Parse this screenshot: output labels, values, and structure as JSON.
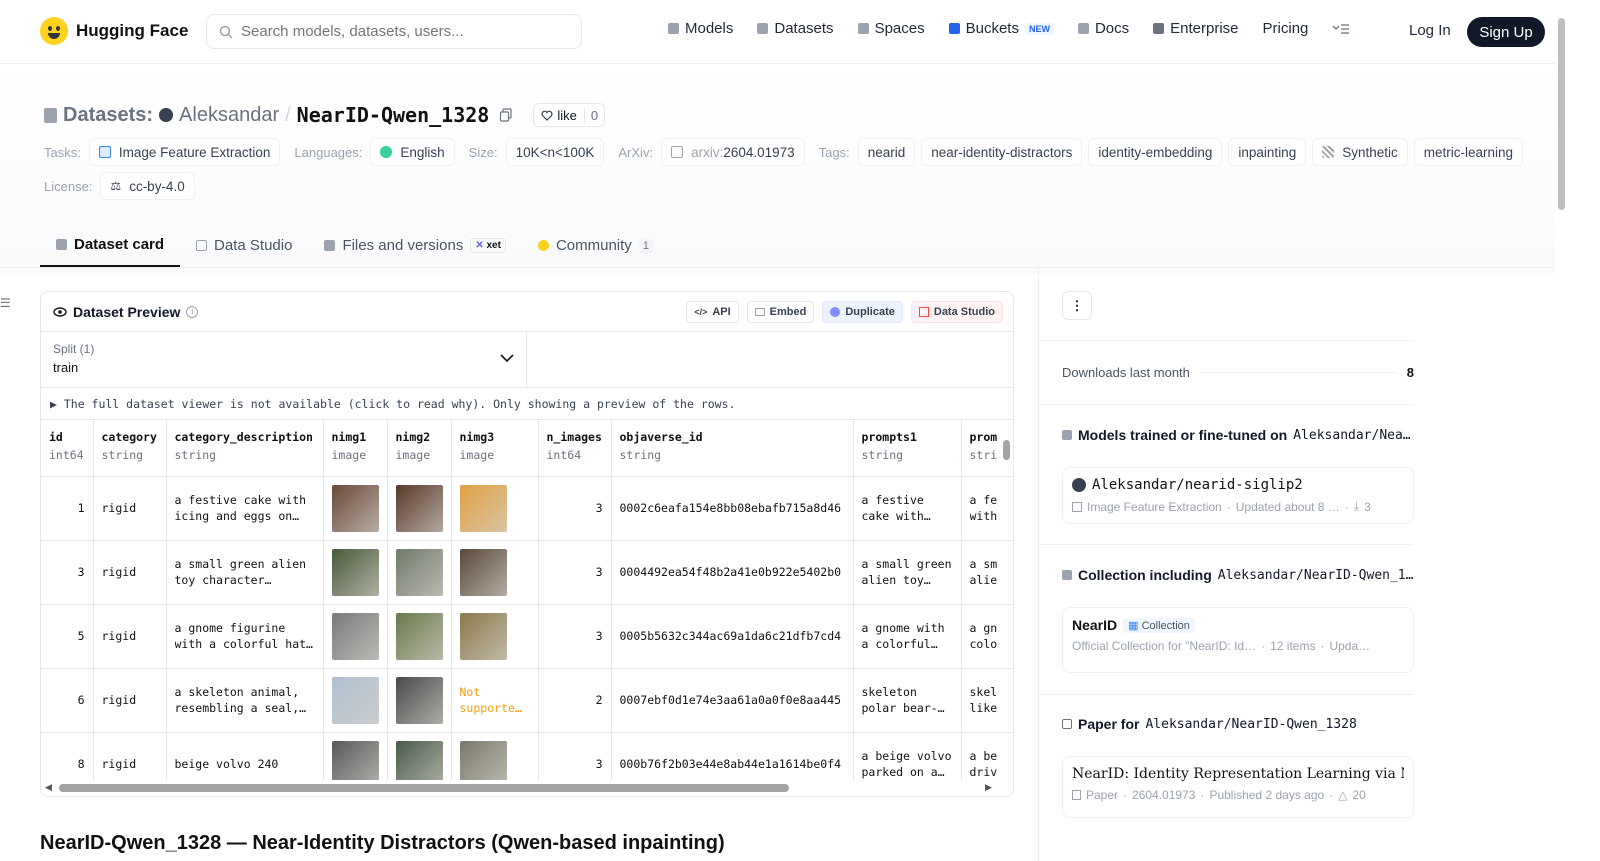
{
  "nav": {
    "brand": "Hugging Face",
    "search_placeholder": "Search models, datasets, users...",
    "links": [
      {
        "label": "Models",
        "color": "#9ca3af"
      },
      {
        "label": "Datasets",
        "color": "#9ca3af"
      },
      {
        "label": "Spaces",
        "color": "#9ca3af"
      },
      {
        "label": "Buckets",
        "color": "#2563eb",
        "badge": "NEW"
      },
      {
        "label": "Docs",
        "color": "#9ca3af"
      },
      {
        "label": "Enterprise",
        "color": "#6b7280"
      },
      {
        "label": "Pricing"
      }
    ],
    "login": "Log In",
    "signup": "Sign Up"
  },
  "header": {
    "section_label": "Datasets:",
    "owner": "Aleksandar",
    "slash": "/",
    "name": "NearID-Qwen_1328",
    "like_label": "like",
    "like_count": "0",
    "tasks_label": "Tasks:",
    "task": "Image Feature Extraction",
    "languages_label": "Languages:",
    "language": "English",
    "size_label": "Size:",
    "size": "10K<n<100K",
    "arxiv_label": "ArXiv:",
    "arxiv_prefix": "arxiv:",
    "arxiv": "2604.01973",
    "tags_label": "Tags:",
    "tags": [
      "nearid",
      "near-identity-distractors",
      "identity-embedding",
      "inpainting",
      "Synthetic",
      "metric-learning"
    ],
    "license_label": "License:",
    "license": "cc-by-4.0"
  },
  "tabs": [
    {
      "label": "Dataset card",
      "active": true
    },
    {
      "label": "Data Studio"
    },
    {
      "label": "Files and versions",
      "badge": "xet"
    },
    {
      "label": "Community",
      "count": "1"
    }
  ],
  "preview": {
    "title": "Dataset Preview",
    "buttons": [
      "API",
      "Embed",
      "Duplicate",
      "Data Studio"
    ],
    "split_label": "Split (1)",
    "split_value": "train",
    "notice": "▶ The full dataset viewer is not available (click to read why). Only showing a preview of the rows.",
    "columns": [
      {
        "name": "id",
        "type": "int64"
      },
      {
        "name": "category",
        "type": "string"
      },
      {
        "name": "category_description",
        "type": "string"
      },
      {
        "name": "nimg1",
        "type": "image"
      },
      {
        "name": "nimg2",
        "type": "image"
      },
      {
        "name": "nimg3",
        "type": "image"
      },
      {
        "name": "n_images",
        "type": "int64"
      },
      {
        "name": "objaverse_id",
        "type": "string"
      },
      {
        "name": "prompts1",
        "type": "string"
      },
      {
        "name": "prom",
        "type": "stri"
      }
    ],
    "rows": [
      {
        "id": "1",
        "category": "rigid",
        "desc": "a festive cake with icing and eggs on…",
        "img": [
          "#6b4a3a",
          "#5a3a2a",
          "#e0a040"
        ],
        "n": "3",
        "obj": "0002c6eafa154e8bb08ebafb715a8d46",
        "p1": "a festive cake with…",
        "p2": "a fe with"
      },
      {
        "id": "3",
        "category": "rigid",
        "desc": "a small green alien toy character…",
        "img": [
          "#4a5a3a",
          "#707a6a",
          "#5a4a3a"
        ],
        "n": "3",
        "obj": "0004492ea54f48b2a41e0b922e5402b0",
        "p1": "a small green alien toy…",
        "p2": "a sm alie"
      },
      {
        "id": "5",
        "category": "rigid",
        "desc": "a gnome figurine with a colorful hat…",
        "img": [
          "#7a7a7a",
          "#6a7a4a",
          "#8a7a4a"
        ],
        "n": "3",
        "obj": "0005b5632c344ac69a1da6c21dfb7cd4",
        "p1": "a gnome with a colorful…",
        "p2": "a gn colo"
      },
      {
        "id": "6",
        "category": "rigid",
        "desc": "a skeleton animal, resembling a seal,…",
        "img": [
          "#b0c0d0",
          "#4a4a4a",
          null
        ],
        "not_supported": "Not supporte…",
        "n": "2",
        "obj": "0007ebf0d1e74e3aa61a0a0f0e8aa445",
        "p1": "skeleton polar bear-…",
        "p2": "skel like"
      },
      {
        "id": "8",
        "category": "rigid",
        "desc": "beige volvo 240",
        "img": [
          "#5a5a5a",
          "#4a5a4a",
          "#7a7a6a"
        ],
        "n": "3",
        "obj": "000b76f2b03e44e8ab44e1a1614be0f4",
        "p1": "a beige volvo parked on a…",
        "p2": "a be driv"
      }
    ]
  },
  "sidebar": {
    "downloads_label": "Downloads last month",
    "downloads": "8",
    "models_title": "Models trained or fine-tuned on",
    "models_ref": "Aleksandar/Nea…",
    "model_name": "Aleksandar/nearid-siglip2",
    "model_task": "Image Feature Extraction",
    "model_updated": "Updated about 8 …",
    "model_downloads": "3",
    "collection_title": "Collection including",
    "collection_ref": "Aleksandar/NearID-Qwen_1…",
    "collection_name": "NearID",
    "collection_badge": "Collection",
    "collection_desc": "Official Collection for \"NearID: Id…",
    "collection_items": "12 items",
    "collection_upd": "Upda…",
    "paper_title": "Paper for",
    "paper_ref": "Aleksandar/NearID-Qwen_1328",
    "paper_name": "NearID: Identity Representation Learning via Near…",
    "paper_type": "Paper",
    "paper_id": "2604.01973",
    "paper_published": "Published 2 days ago",
    "paper_upvotes": "20"
  },
  "card_heading": "NearID-Qwen_1328 — Near-Identity Distractors (Qwen-based inpainting)"
}
